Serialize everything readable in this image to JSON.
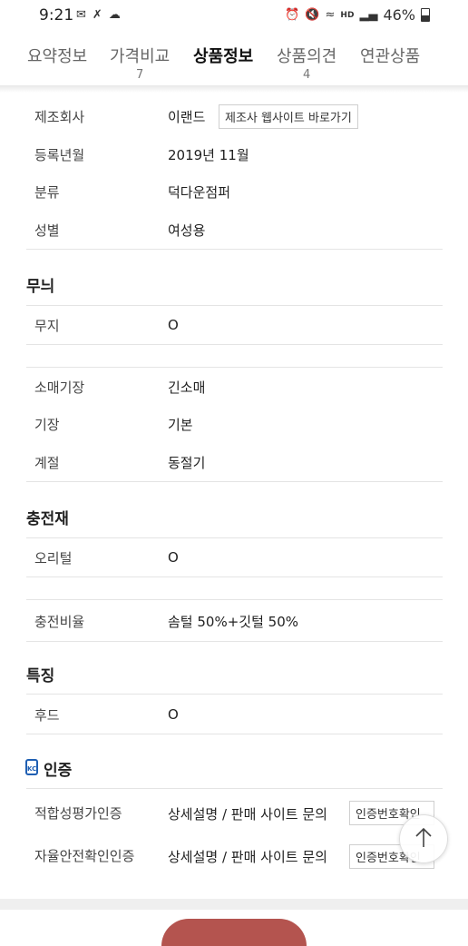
{
  "status_bar": {
    "time": "9:21",
    "battery": "46%",
    "left_icons": [
      "message-icon",
      "x-icon",
      "cloud-icon"
    ],
    "right_icons": [
      "alarm-icon",
      "mute-icon",
      "wifi-icon",
      "hd-voice-icon",
      "signal-icon",
      "battery-icon"
    ]
  },
  "tabs": [
    {
      "label": "요약정보",
      "count": ""
    },
    {
      "label": "가격비교",
      "count": "7"
    },
    {
      "label": "상품정보",
      "count": "",
      "active": true
    },
    {
      "label": "상품의견",
      "count": "4"
    },
    {
      "label": "연관상품",
      "count": ""
    }
  ],
  "basic_info": {
    "manufacturer_label": "제조회사",
    "manufacturer_value": "이랜드",
    "manufacturer_link": "제조사 웹사이트 바로가기",
    "reg_label": "등록년월",
    "reg_value": "2019년 11월",
    "category_label": "분류",
    "category_value": "덕다운점퍼",
    "gender_label": "성별",
    "gender_value": "여성용"
  },
  "pattern": {
    "title": "무늬",
    "plain_label": "무지",
    "plain_value": "O"
  },
  "shape": {
    "sleeve_label": "소매기장",
    "sleeve_value": "긴소매",
    "length_label": "기장",
    "length_value": "기본",
    "season_label": "계절",
    "season_value": "동절기"
  },
  "filling": {
    "title": "충전재",
    "duck_label": "오리털",
    "duck_value": "O",
    "ratio_label": "충전비율",
    "ratio_value": "솜털 50%+깃털 50%"
  },
  "feature": {
    "title": "특징",
    "hood_label": "후드",
    "hood_value": "O"
  },
  "certification": {
    "title": "인증",
    "kc_mark": "KC",
    "conformity_label": "적합성평가인증",
    "conformity_value": "상세설명 / 판매 사이트 문의",
    "conformity_button": "인증번호확인",
    "safety_label": "자율안전확인인증",
    "safety_value": "상세설명 / 판매 사이트 문의",
    "safety_button": "인증번호확인"
  },
  "accent_colors": {
    "kc_blue": "#1f5fb3",
    "product_image_red": "#b4544f"
  }
}
